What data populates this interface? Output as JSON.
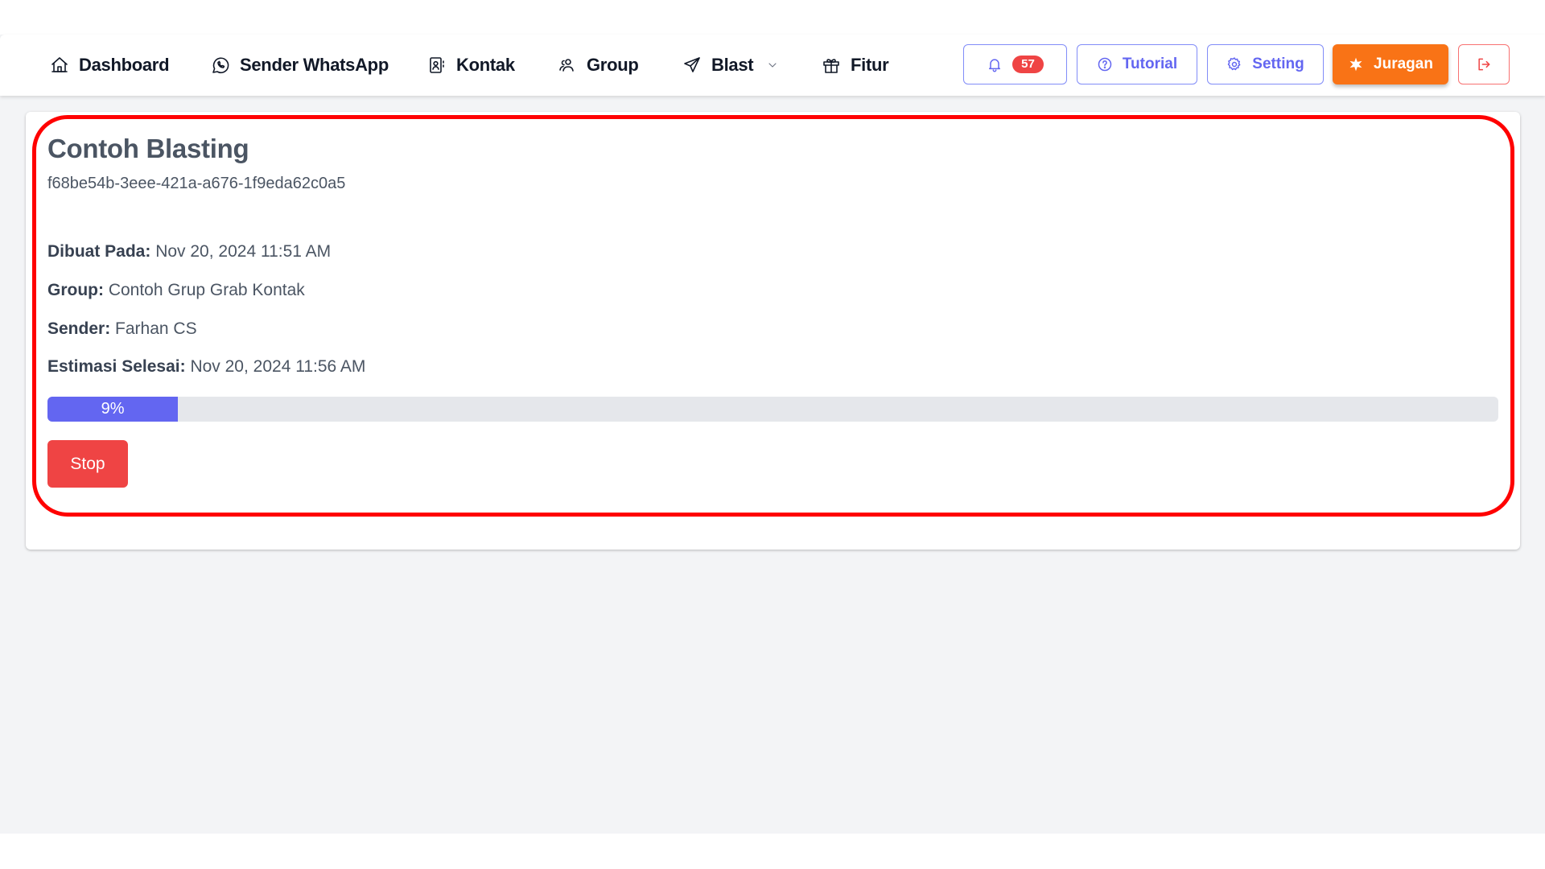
{
  "nav": {
    "items": [
      {
        "label": "Dashboard",
        "icon": "home-icon"
      },
      {
        "label": "Sender WhatsApp",
        "icon": "whatsapp-icon"
      },
      {
        "label": "Kontak",
        "icon": "contact-book-icon"
      },
      {
        "label": "Group",
        "icon": "users-icon"
      },
      {
        "label": "Blast",
        "icon": "send-icon",
        "has_dropdown": true
      },
      {
        "label": "Fitur",
        "icon": "gift-icon"
      }
    ],
    "notification_count": "57",
    "tutorial_label": "Tutorial",
    "setting_label": "Setting",
    "juragan_label": "Juragan"
  },
  "blast": {
    "title": "Contoh Blasting",
    "id": "f68be54b-3eee-421a-a676-1f9eda62c0a5",
    "fields": [
      {
        "label": "Dibuat Pada:",
        "value": "Nov 20, 2024 11:51 AM"
      },
      {
        "label": "Group:",
        "value": "Contoh Grup Grab Kontak"
      },
      {
        "label": "Sender:",
        "value": "Farhan CS"
      },
      {
        "label": "Estimasi Selesai:",
        "value": "Nov 20, 2024 11:56 AM"
      }
    ],
    "progress_percent": 9,
    "progress_label": "9%",
    "stop_label": "Stop"
  },
  "colors": {
    "accent": "#6366f1",
    "danger": "#ef4444",
    "brand_orange": "#f97316",
    "highlight": "#ff0000"
  }
}
